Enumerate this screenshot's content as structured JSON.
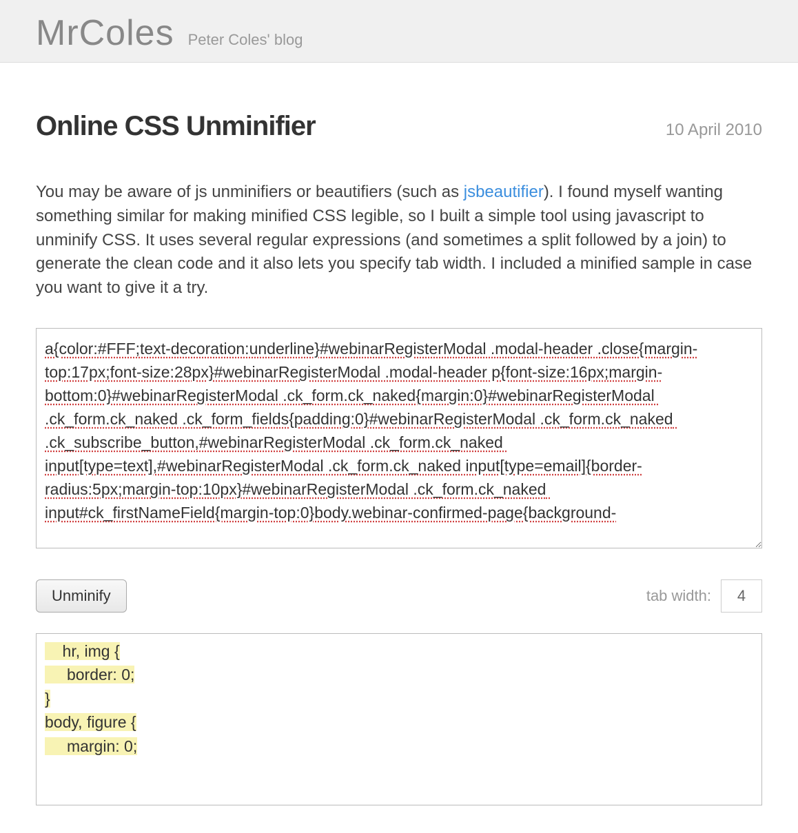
{
  "header": {
    "site_title": "MrColes",
    "site_subtitle": "Peter Coles' blog"
  },
  "post": {
    "title": "Online CSS Unminifier",
    "date": "10 April 2010",
    "intro_before_link": "You may be aware of js unminifiers or beautifiers (such as ",
    "link_text": "jsbeautifier",
    "intro_after_link": "). I found myself wanting something similar for making minified CSS legible, so I built a simple tool using javascript to unminify CSS. It uses several regular expressions (and sometimes a split followed by a join) to generate the clean code and it also lets you specify tab width. I included a minified sample in case you want to give it a try."
  },
  "input_css": "a{color:#FFF;text-decoration:underline}#webinarRegisterModal .modal-header .close{margin-top:17px;font-size:28px}#webinarRegisterModal .modal-header p{font-size:16px;margin-bottom:0}#webinarRegisterModal .ck_form.ck_naked{margin:0}#webinarRegisterModal .ck_form.ck_naked .ck_form_fields{padding:0}#webinarRegisterModal .ck_form.ck_naked .ck_subscribe_button,#webinarRegisterModal .ck_form.ck_naked input[type=text],#webinarRegisterModal .ck_form.ck_naked input[type=email]{border-radius:5px;margin-top:10px}#webinarRegisterModal .ck_form.ck_naked input#ck_firstNameField{margin-top:0}body.webinar-confirmed-page{background-",
  "controls": {
    "unminify_label": "Unminify",
    "tab_width_label": "tab width:",
    "tab_width_value": "4"
  },
  "output_lines": [
    {
      "indent": 1,
      "text": "hr, img {",
      "hl": true
    },
    {
      "indent": 1,
      "text": " border: 0;",
      "hl": true
    },
    {
      "indent": 0,
      "text": "}",
      "hl": true
    },
    {
      "indent": 0,
      "text": "body, figure {",
      "hl": true
    },
    {
      "indent": 1,
      "text": " margin: 0;",
      "hl": true
    }
  ]
}
